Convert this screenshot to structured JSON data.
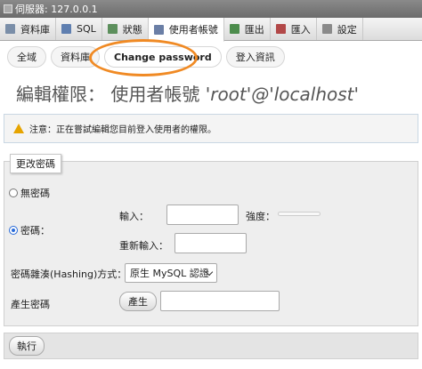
{
  "window": {
    "server_label": "伺服器: 127.0.0.1"
  },
  "tabs": [
    {
      "label": "資料庫",
      "icon": "database-icon"
    },
    {
      "label": "SQL",
      "icon": "sql-icon"
    },
    {
      "label": "狀態",
      "icon": "status-icon"
    },
    {
      "label": "使用者帳號",
      "icon": "users-icon",
      "active": true
    },
    {
      "label": "匯出",
      "icon": "export-icon"
    },
    {
      "label": "匯入",
      "icon": "import-icon"
    },
    {
      "label": "設定",
      "icon": "settings-icon"
    }
  ],
  "subtabs": [
    {
      "label": "全域"
    },
    {
      "label": "資料庫"
    },
    {
      "label": "Change password",
      "active": true
    },
    {
      "label": "登入資訊"
    }
  ],
  "page": {
    "title_prefix": "編輯權限： 使用者帳號 ",
    "title_user": "'root'@'localhost'"
  },
  "notice": {
    "text": "注意：正在嘗試編輯您目前登入使用者的權限。"
  },
  "form": {
    "legend": "更改密碼",
    "no_password_label": "無密碼",
    "password_label": "密碼：",
    "enter_label": "輸入：",
    "strength_label": "強度：",
    "retype_label": "重新輸入：",
    "hashing_label": "密碼雜湊(Hashing)方式：",
    "hashing_selected": "原生 MySQL 認證",
    "generate_label": "產生密碼",
    "generate_button": "產生",
    "password_value": "",
    "retype_value": "",
    "generated_value": "",
    "selected_option": "password",
    "strength": 0
  },
  "footer": {
    "go_button": "執行"
  },
  "colors": {
    "highlight_oval": "#f08a24",
    "radio_checked": "#2a6bd8",
    "warning": "#e6a400"
  }
}
